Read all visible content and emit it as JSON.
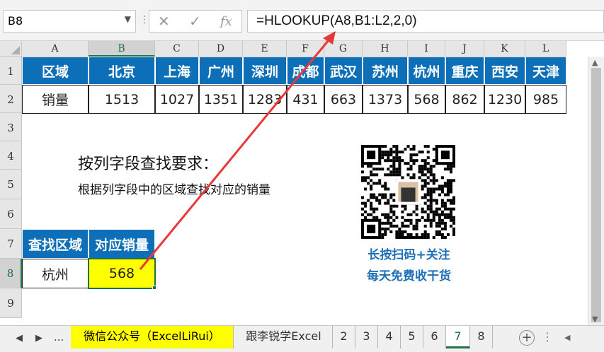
{
  "formula_bar": {
    "name_box": "B8",
    "formula": "=HLOOKUP(A8,B1:L2,2,0)"
  },
  "columns": [
    "A",
    "B",
    "C",
    "D",
    "E",
    "F",
    "G",
    "H",
    "I",
    "J",
    "K",
    "L"
  ],
  "rows": [
    "1",
    "2",
    "3",
    "4",
    "5",
    "6",
    "7",
    "8",
    "9"
  ],
  "table": {
    "header_label": "区域",
    "row_label": "销量",
    "cities": [
      "北京",
      "上海",
      "广州",
      "深圳",
      "成都",
      "武汉",
      "苏州",
      "杭州",
      "重庆",
      "西安",
      "天津"
    ],
    "values": [
      "1513",
      "1027",
      "1351",
      "1283",
      "431",
      "663",
      "1373",
      "568",
      "862",
      "1230",
      "985"
    ]
  },
  "instructions": {
    "title": "按列字段查找要求：",
    "subtitle": "根据列字段中的区域查找对应的销量"
  },
  "lookup": {
    "header_a": "查找区域",
    "header_b": "对应销量",
    "query": "杭州",
    "result": "568"
  },
  "promo": {
    "line1": "长按扫码+关注",
    "line2": "每天免费收干货"
  },
  "tabs": {
    "ellipsis": "...",
    "items": [
      "微信公众号（ExcelLiRui）",
      "跟李锐学Excel",
      "2",
      "3",
      "4",
      "5",
      "6",
      "7",
      "8"
    ],
    "active": "7"
  },
  "colors": {
    "header_blue": "#0c6fb8",
    "highlight": "#ffff00",
    "arrow": "#e8393a",
    "excel_green": "#217346"
  },
  "icons": [
    "cancel-icon",
    "enter-icon",
    "function-icon",
    "add-sheet-icon",
    "qr-code-icon"
  ]
}
